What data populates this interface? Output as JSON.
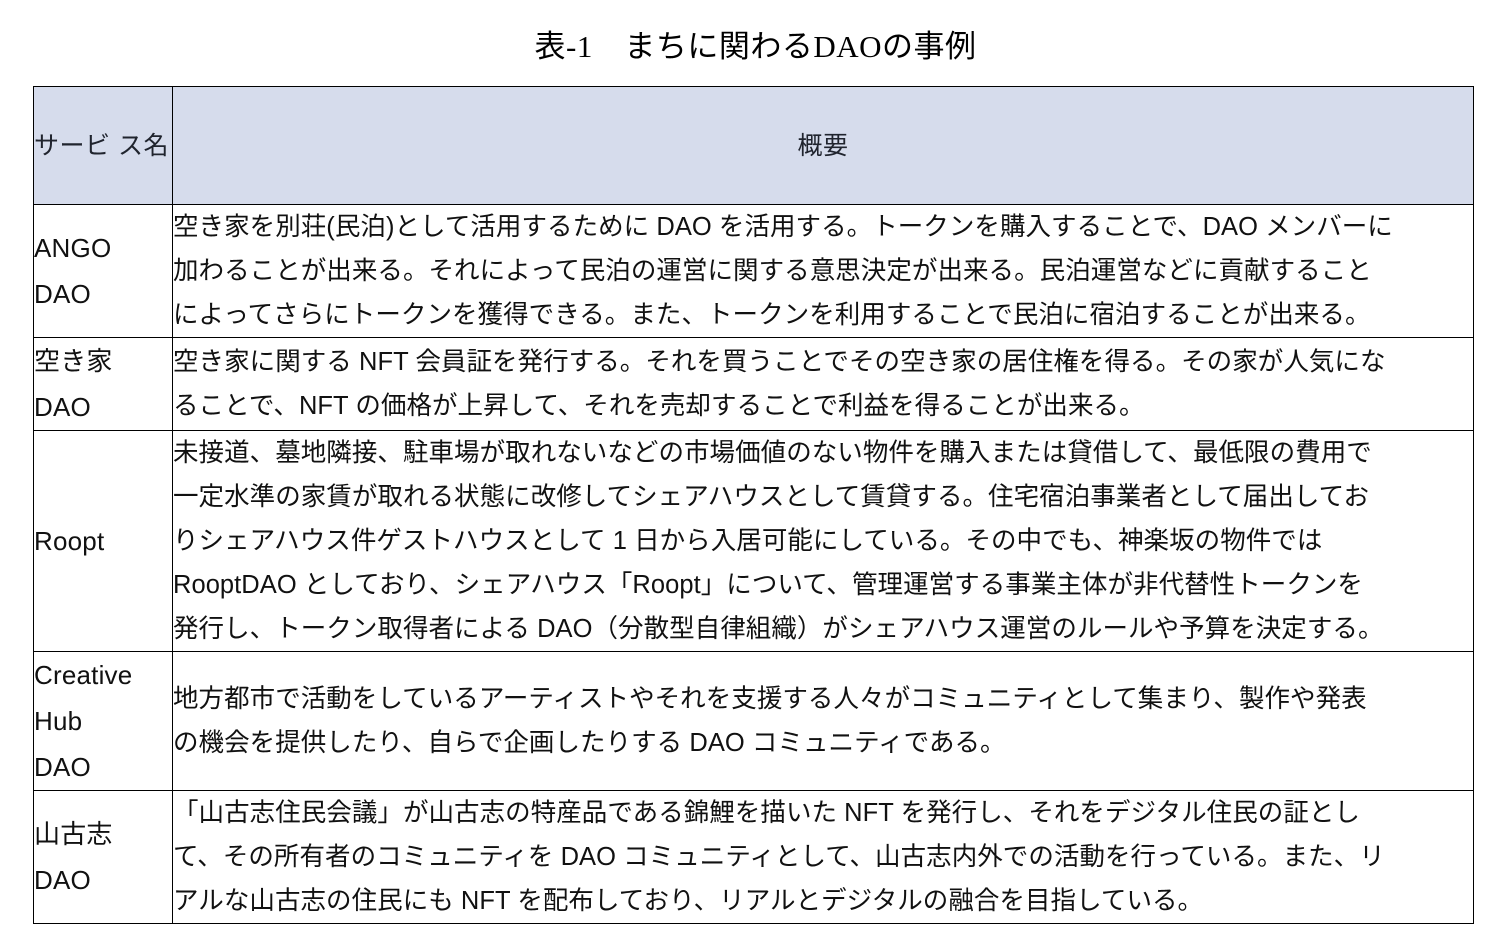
{
  "document": {
    "caption": "表-1　まちに関わるDAOの事例"
  },
  "table": {
    "columns": {
      "name_header": "サービス名",
      "name_header_lines": [
        "サービ",
        "ス名"
      ],
      "desc_header": "概要"
    },
    "rows": [
      {
        "name": "ANGO DAO",
        "name_lines": [
          "ANGO",
          "DAO"
        ],
        "description": "空き家を別荘(民泊)として活用するためにDAOを活用する。トークンを購入することで、DAOメンバーに加わることが出来る。それによって民泊の運営に関する意思決定が出来る。民泊運営などに貢献することによってさらにトークンを獲得できる。また、トークンを利用することで民泊に宿泊することが出来る。",
        "description_lines": [
          "空き家を別荘(民泊)として活用するために DAO を活用する。トークンを購入することで、DAO メンバーに",
          "加わることが出来る。それによって民泊の運営に関する意思決定が出来る。民泊運営などに貢献すること",
          "によってさらにトークンを獲得できる。また、トークンを利用することで民泊に宿泊することが出来る。"
        ]
      },
      {
        "name": "空き家 DAO",
        "name_lines": [
          "空き家",
          "DAO"
        ],
        "description": "空き家に関するNFT会員証を発行する。それを買うことでその空き家の居住権を得る。その家が人気になることで、NFTの価格が上昇して、それを売却することで利益を得ることが出来る。",
        "description_lines": [
          "空き家に関する NFT 会員証を発行する。それを買うことでその空き家の居住権を得る。その家が人気にな",
          "ることで、NFT の価格が上昇して、それを売却することで利益を得ることが出来る。"
        ]
      },
      {
        "name": "Roopt",
        "name_lines": [
          "Roopt"
        ],
        "description": "未接道、墓地隣接、駐車場が取れないなどの市場価値のない物件を購入または貸借して、最低限の費用で一定水準の家賃が取れる状態に改修してシェアハウスとして賃貸する。住宅宿泊事業者として届出しておりシェアハウス件ゲストハウスとして1日から入居可能にしている。その中でも、神楽坂の物件ではRooptDAOとしており、シェアハウス「Roopt」について、管理運営する事業主体が非代替性トークンを発行し、トークン取得者によるDAO（分散型自律組織）がシェアハウス運営のルールや予算を決定する。",
        "description_lines": [
          "未接道、墓地隣接、駐車場が取れないなどの市場価値のない物件を購入または貸借して、最低限の費用で",
          "一定水準の家賃が取れる状態に改修してシェアハウスとして賃貸する。住宅宿泊事業者として届出してお",
          "りシェアハウス件ゲストハウスとして 1 日から入居可能にしている。その中でも、神楽坂の物件では",
          "RooptDAO としており、シェアハウス「Roopt」について、管理運営する事業主体が非代替性トークンを",
          "発行し、トークン取得者による DAO（分散型自律組織）がシェアハウス運営のルールや予算を決定する。"
        ]
      },
      {
        "name": "Creative Hub DAO",
        "name_lines": [
          "Creative",
          "Hub",
          "DAO"
        ],
        "description": "地方都市で活動をしているアーティストやそれを支援する人々がコミュニティとして集まり、製作や発表の機会を提供したり、自らで企画したりするDAOコミュニティである。",
        "description_lines": [
          "地方都市で活動をしているアーティストやそれを支援する人々がコミュニティとして集まり、製作や発表",
          "の機会を提供したり、自らで企画したりする DAO コミュニティである。"
        ]
      },
      {
        "name": "山古志 DAO",
        "name_lines": [
          "山古志",
          "DAO"
        ],
        "description": "「山古志住民会議」が山古志の特産品である錦鯉を描いたNFTを発行し、それをデジタル住民の証として、その所有者のコミュニティをDAOコミュニティとして、山古志内外での活動を行っている。また、リアルな山古志の住民にもNFTを配布しており、リアルとデジタルの融合を目指している。",
        "description_lines": [
          "「山古志住民会議」が山古志の特産品である錦鯉を描いた NFT を発行し、それをデジタル住民の証とし",
          "て、その所有者のコミュニティを DAO コミュニティとして、山古志内外での活動を行っている。また、リ",
          "アルな山古志の住民にも NFT を配布しており、リアルとデジタルの融合を目指している。"
        ]
      }
    ]
  },
  "colors": {
    "header_background": "#d6dcec",
    "border": "#000000",
    "text": "#111111",
    "page_background": "#ffffff"
  }
}
